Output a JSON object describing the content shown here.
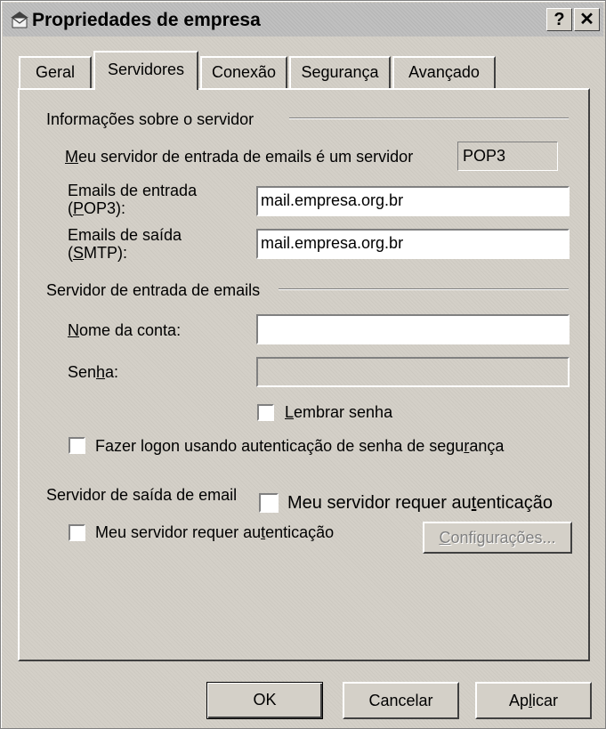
{
  "window": {
    "title": "Propriedades de empresa",
    "help_btn": "?",
    "close_btn": "✕"
  },
  "tabs": [
    {
      "label": "Geral"
    },
    {
      "label": "Servidores",
      "active": true
    },
    {
      "label": "Conexão"
    },
    {
      "label": "Segurança"
    },
    {
      "label": "Avançado"
    }
  ],
  "server_info": {
    "group_label": "Informações sobre o servidor",
    "incoming_type_prefix": "M",
    "incoming_type_label": "eu servidor de entrada de emails é um  servidor",
    "incoming_type_value": "POP3",
    "incoming_label_line1": "Emails de entrada",
    "incoming_label_line2_pre": "(",
    "incoming_label_line2_u": "P",
    "incoming_label_line2_post": "OP3):",
    "incoming_value": "mail.empresa.org.br",
    "outgoing_label_line1": "Emails de saída",
    "outgoing_label_line2_pre": "(",
    "outgoing_label_line2_u": "S",
    "outgoing_label_line2_post": "MTP):",
    "outgoing_value": "mail.empresa.org.br"
  },
  "incoming_server": {
    "group_label": "Servidor de entrada de emails",
    "account_u": "N",
    "account_rest": "ome da conta:",
    "account_value": "",
    "password_pre": "Sen",
    "password_u": "h",
    "password_post": "a:",
    "password_value": "",
    "remember_u": "L",
    "remember_rest": "embrar senha",
    "remember_checked": false,
    "spa_pre": "Fazer logon usando autenticação de senha de segu",
    "spa_u": "r",
    "spa_post": "ança",
    "spa_checked": false
  },
  "outgoing_server": {
    "group_label": "Servidor de saída de email",
    "overlay_auth_pre": "Meu servidor requer au",
    "overlay_auth_u": "t",
    "overlay_auth_post": "enticação",
    "auth_pre": "Meu servidor requer au",
    "auth_u": "t",
    "auth_post": "enticação",
    "auth_checked": false,
    "settings_u": "C",
    "settings_rest": "onfigurações..."
  },
  "buttons": {
    "ok": "OK",
    "cancel": "Cancelar",
    "apply_pre": "Ap",
    "apply_u": "l",
    "apply_post": "icar"
  }
}
